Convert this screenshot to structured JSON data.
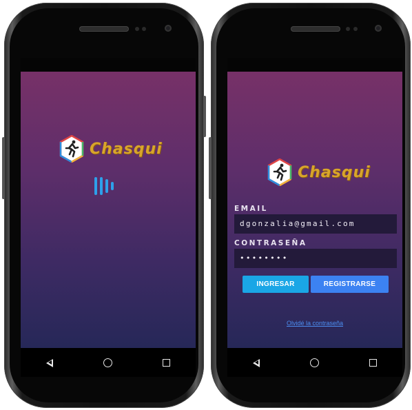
{
  "splash": {
    "app_name": "Chasqui",
    "logo_icon": "runner-hexagon-icon",
    "loader_icon": "equalizer-bars-icon",
    "colors": {
      "loader": "#2ea0ea",
      "logo_text": "#d8a52a"
    }
  },
  "login": {
    "app_name": "Chasqui",
    "logo_icon": "runner-hexagon-icon",
    "email": {
      "label": "EMAIL",
      "value": "dgonzalia@gmail.com"
    },
    "password": {
      "label": "CONTRASEÑA",
      "value": "••••••••"
    },
    "buttons": {
      "login": "INGRESAR",
      "register": "REGISTRARSE"
    },
    "forgot_link": "Olvidé la contraseña",
    "colors": {
      "login_button": "#1aa6e6",
      "register_button": "#3c82f2",
      "link": "#4c8df0"
    }
  },
  "navbar": {
    "back_icon": "back-triangle-icon",
    "home_icon": "home-circle-icon",
    "recents_icon": "recents-square-icon"
  }
}
